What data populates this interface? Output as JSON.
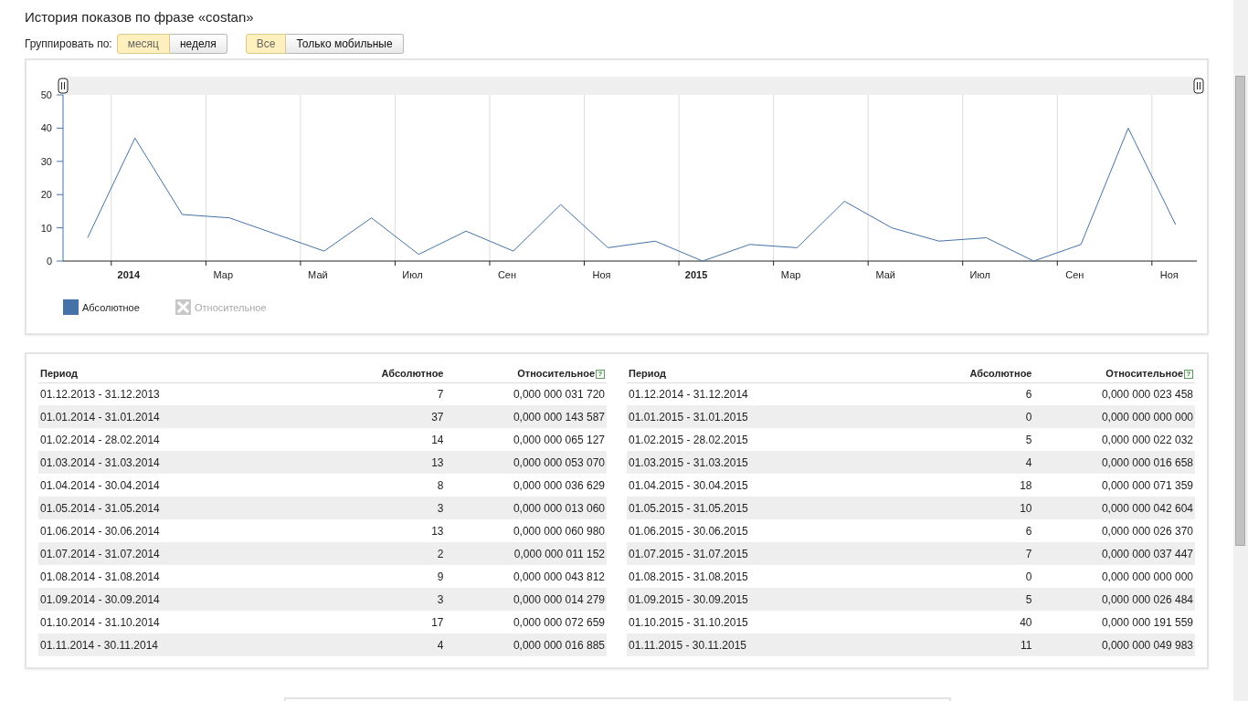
{
  "title": "История показов по фразе «costan»",
  "group_by": {
    "label": "Группировать по:",
    "options": [
      {
        "label": "месяц",
        "selected": true
      },
      {
        "label": "неделя",
        "selected": false
      }
    ]
  },
  "device_filter": {
    "options": [
      {
        "label": "Все",
        "selected": true
      },
      {
        "label": "Только мобильные",
        "selected": false
      }
    ]
  },
  "chart": {
    "legend": [
      {
        "enabled": true
      },
      {
        "label": "Относительное",
        "enabled": false
      }
    ],
    "chart_data": {
      "type": "line",
      "categories": [
        null,
        "2014",
        null,
        "Мар",
        null,
        "Май",
        null,
        "Июл",
        null,
        "Сен",
        null,
        "Ноя",
        null,
        "2015",
        null,
        "Мар",
        null,
        "Май",
        null,
        "Июл",
        null,
        "Сен",
        null,
        "Ноя"
      ],
      "series": [
        {
          "name": "Абсолютное",
          "color": "#4572a7",
          "values": [
            7,
            37,
            14,
            13,
            8,
            3,
            13,
            2,
            9,
            3,
            17,
            4,
            6,
            0,
            5,
            4,
            18,
            10,
            6,
            7,
            0,
            5,
            40,
            11
          ]
        }
      ],
      "ylim": [
        0,
        50
      ],
      "yticks": [
        0,
        10,
        20,
        30,
        40,
        50
      ]
    }
  },
  "tables": [
    {
      "columns": [
        "Период",
        "Абсолютное",
        "Относительное"
      ],
      "help": "?",
      "rows": [
        {
          "period": "01.12.2013 - 31.12.2013",
          "absolute": "7",
          "relative": "0,000 000 031 720"
        },
        {
          "period": "01.01.2014 - 31.01.2014",
          "absolute": "37",
          "relative": "0,000 000 143 587"
        },
        {
          "period": "01.02.2014 - 28.02.2014",
          "absolute": "14",
          "relative": "0,000 000 065 127"
        },
        {
          "period": "01.03.2014 - 31.03.2014",
          "absolute": "13",
          "relative": "0,000 000 053 070"
        },
        {
          "period": "01.04.2014 - 30.04.2014",
          "absolute": "8",
          "relative": "0,000 000 036 629"
        },
        {
          "period": "01.05.2014 - 31.05.2014",
          "absolute": "3",
          "relative": "0,000 000 013 060"
        },
        {
          "period": "01.06.2014 - 30.06.2014",
          "absolute": "13",
          "relative": "0,000 000 060 980"
        },
        {
          "period": "01.07.2014 - 31.07.2014",
          "absolute": "2",
          "relative": "0,000 000 011 152"
        },
        {
          "period": "01.08.2014 - 31.08.2014",
          "absolute": "9",
          "relative": "0,000 000 043 812"
        },
        {
          "period": "01.09.2014 - 30.09.2014",
          "absolute": "3",
          "relative": "0,000 000 014 279"
        },
        {
          "period": "01.10.2014 - 31.10.2014",
          "absolute": "17",
          "relative": "0,000 000 072 659"
        },
        {
          "period": "01.11.2014 - 30.11.2014",
          "absolute": "4",
          "relative": "0,000 000 016 885"
        }
      ]
    },
    {
      "columns": [
        "Период",
        "Абсолютное",
        "Относительное"
      ],
      "help": "?",
      "rows": [
        {
          "period": "01.12.2014 - 31.12.2014",
          "absolute": "6",
          "relative": "0,000 000 023 458"
        },
        {
          "period": "01.01.2015 - 31.01.2015",
          "absolute": "0",
          "relative": "0,000 000 000 000"
        },
        {
          "period": "01.02.2015 - 28.02.2015",
          "absolute": "5",
          "relative": "0,000 000 022 032"
        },
        {
          "period": "01.03.2015 - 31.03.2015",
          "absolute": "4",
          "relative": "0,000 000 016 658"
        },
        {
          "period": "01.04.2015 - 30.04.2015",
          "absolute": "18",
          "relative": "0,000 000 071 359"
        },
        {
          "period": "01.05.2015 - 31.05.2015",
          "absolute": "10",
          "relative": "0,000 000 042 604"
        },
        {
          "period": "01.06.2015 - 30.06.2015",
          "absolute": "6",
          "relative": "0,000 000 026 370"
        },
        {
          "period": "01.07.2015 - 31.07.2015",
          "absolute": "7",
          "relative": "0,000 000 037 447"
        },
        {
          "period": "01.08.2015 - 31.08.2015",
          "absolute": "0",
          "relative": "0,000 000 000 000"
        },
        {
          "period": "01.09.2015 - 30.09.2015",
          "absolute": "5",
          "relative": "0,000 000 026 484"
        },
        {
          "period": "01.10.2015 - 31.10.2015",
          "absolute": "40",
          "relative": "0,000 000 191 559"
        },
        {
          "period": "01.11.2015 - 30.11.2015",
          "absolute": "11",
          "relative": "0,000 000 049 983"
        }
      ]
    }
  ]
}
